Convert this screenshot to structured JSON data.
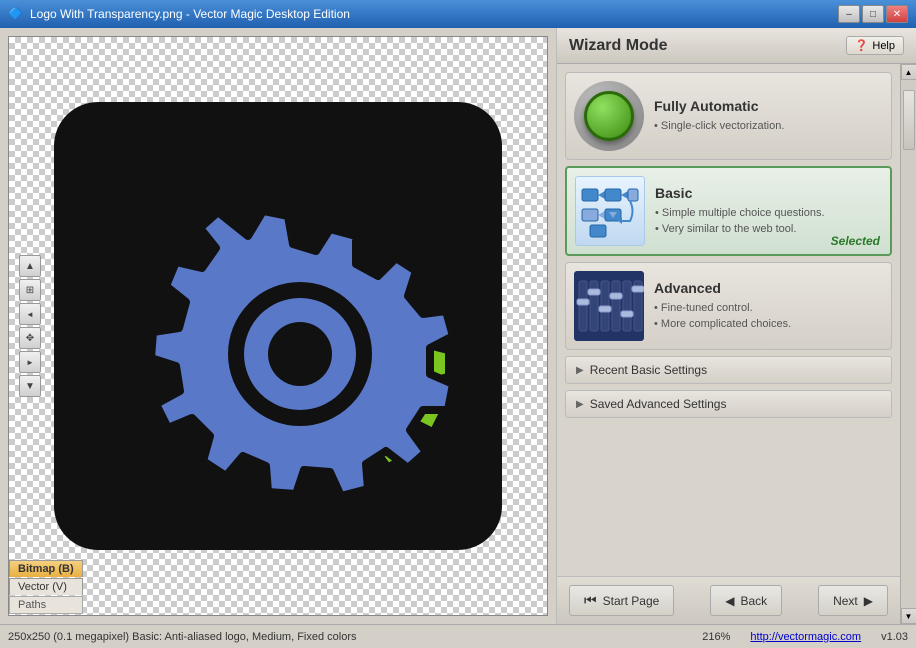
{
  "window": {
    "title": "Logo With Transparency.png - Vector Magic Desktop Edition",
    "icon": "📊"
  },
  "title_buttons": {
    "minimize": "–",
    "maximize": "□",
    "close": "✕"
  },
  "toolbar": {
    "up_arrow": "▲",
    "move": "✥",
    "down_arrow": "▼",
    "left_arrow": "◄",
    "right_arrow": "►"
  },
  "view_tabs": {
    "bitmap": "Bitmap (B)",
    "vector": "Vector (V)",
    "paths": "Paths"
  },
  "wizard": {
    "title": "Wizard Mode",
    "help_label": "Help",
    "modes": [
      {
        "id": "fully-automatic",
        "title": "Fully Automatic",
        "bullets": [
          "Single-click vectorization."
        ],
        "selected": false
      },
      {
        "id": "basic",
        "title": "Basic",
        "bullets": [
          "Simple multiple choice questions.",
          "Very similar to the web tool."
        ],
        "selected": true,
        "selected_label": "Selected"
      },
      {
        "id": "advanced",
        "title": "Advanced",
        "bullets": [
          "Fine-tuned control.",
          "More complicated choices."
        ],
        "selected": false
      }
    ],
    "section_buttons": [
      {
        "label": "Recent Basic Settings"
      },
      {
        "label": "Saved Advanced Settings"
      }
    ]
  },
  "nav": {
    "start_page_label": "Start Page",
    "back_label": "Back",
    "next_label": "Next"
  },
  "status": {
    "info": "250x250 (0.1 megapixel)  Basic: Anti-aliased logo, Medium, Fixed colors",
    "zoom": "216%",
    "url": "http://vectormagic.com",
    "version": "v1.03"
  }
}
